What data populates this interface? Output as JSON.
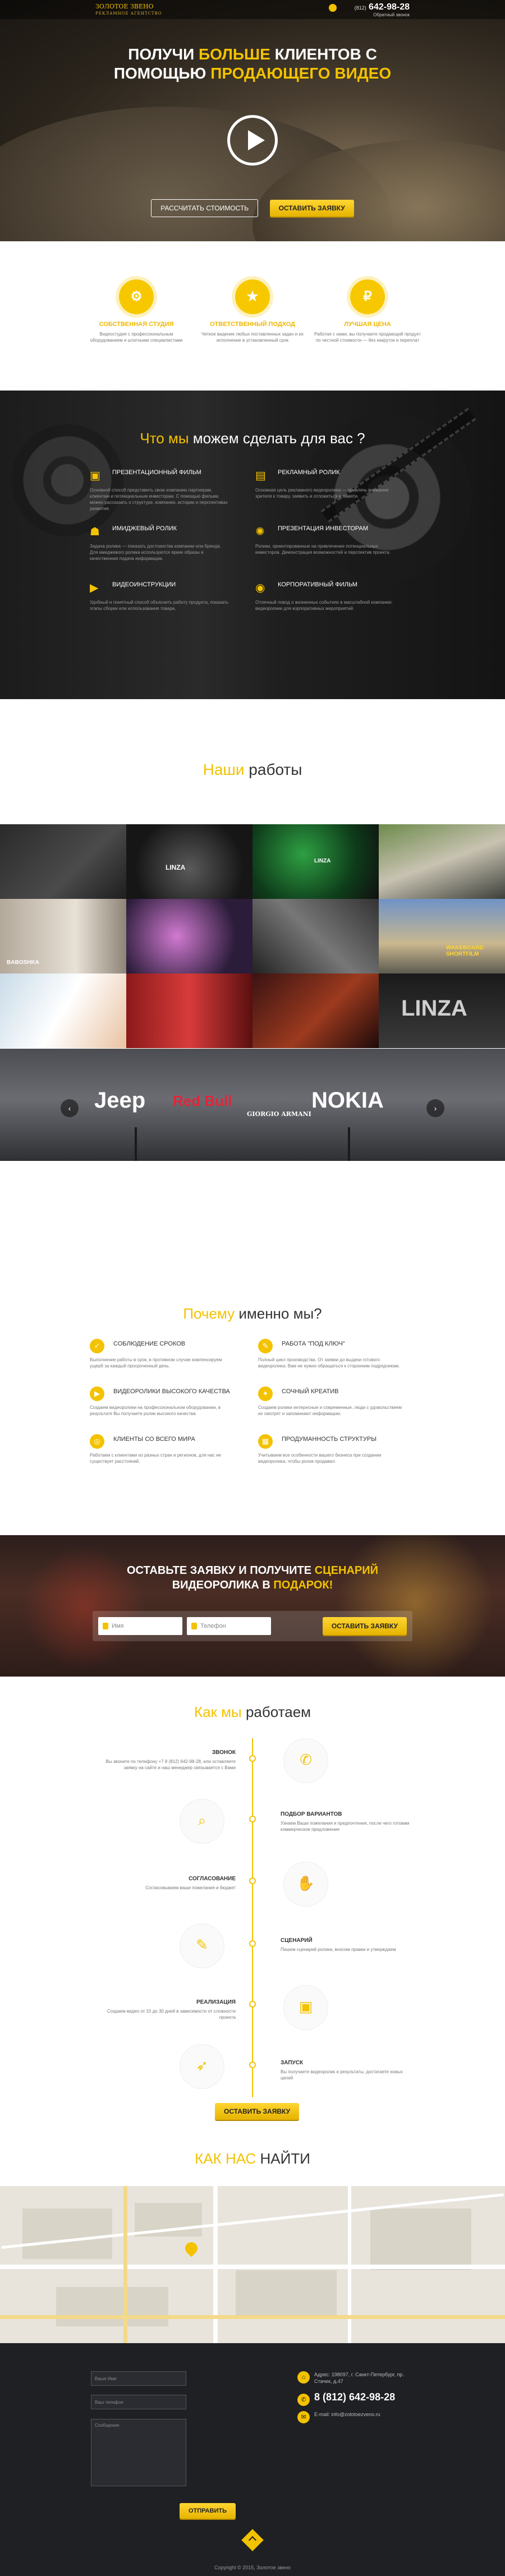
{
  "header": {
    "logo": "ЗОЛОТОЕ ЗВЕНО",
    "logo_sub": "РЕКЛАМНОЕ АГЕНТСТВО",
    "phone_code": "(812)",
    "phone": "642-98-28",
    "callback": "Обратный звонок"
  },
  "hero": {
    "title_1": "Получи",
    "title_2": "больше",
    "title_3": "клиентов с",
    "title_4": "помощью",
    "title_5": "продающего видео",
    "btn_cost": "Рассчитать стоимость",
    "btn_order": "Оставить заявку"
  },
  "features": [
    {
      "icon": "⚙",
      "title": "Собственная студия",
      "desc": "Видеостудия с профессиональным оборудованием и штатными специалистами"
    },
    {
      "icon": "★",
      "title": "Ответственный подход",
      "desc": "Четкое видение любых поставленных задач и их исполнение в установленный срок"
    },
    {
      "icon": "₽",
      "title": "Лучшая цена",
      "desc": "Работая с нами, вы получаете продающий продукт по честной стоимости — без накруток и переплат"
    }
  ],
  "services": {
    "title_1": "Что мы",
    "title_2": "можем",
    "title_3": "сделать для вас ?",
    "items": [
      {
        "icon": "▣",
        "title": "Презентационный фильм",
        "desc": "Основной способ представить свою компанию партнерам, клиентам и потенциальным инвесторам. С помощью фильма можно рассказать о структуре, компании, истории и перспективах развития."
      },
      {
        "icon": "▤",
        "title": "Рекламный ролик",
        "desc": "Основная цель рекламного видеоролика — привлечь внимание зрителя к товару, заявить и отложиться в памяти."
      },
      {
        "icon": "☗",
        "title": "Имиджевый ролик",
        "desc": "Задача ролика — показать достоинства компании или бренда. Для имиджевого ролика используются яркие образы и качественная подача информации."
      },
      {
        "icon": "✺",
        "title": "Презентация инвесторам",
        "desc": "Ролики, ориентированные на привлечение потенциальных инвесторов. Демонстрация возможностей и перспектив проекта."
      },
      {
        "icon": "▶",
        "title": "Видеоинструкции",
        "desc": "Удобный и понятный способ объяснить работу продукта, показать этапы сборки или использования товара."
      },
      {
        "icon": "◉",
        "title": "Корпоративный фильм",
        "desc": "Отличный повод о жизненных событиях в масштабной компании: видеоролики для корпоративных мероприятий."
      }
    ]
  },
  "works": {
    "title_1": "Наши",
    "title_2": "работы",
    "labels": {
      "linza": "LINZA",
      "bavoshka": "BABOSHKA",
      "brand_cell": "LINZA",
      "wake": "WAKEBOARD SHORTFILM",
      "linza_big": "LINZA"
    },
    "brands": [
      "Jeep",
      "Red Bull",
      "GIORGIO ARMANI",
      "NOKIA"
    ]
  },
  "why": {
    "title_1": "Почему",
    "title_2": "именно мы?",
    "items": [
      {
        "icon": "✓",
        "title": "Соблюдение сроков",
        "desc": "Выполнение работы в срок, в противном случае компенсируем ущерб за каждый просроченный день."
      },
      {
        "icon": "✎",
        "title": "Работа \"под ключ\"",
        "desc": "Полный цикл производства. От заявки до выдачи готового видеоролика. Вам не нужно обращаться к сторонним подрядчикам."
      },
      {
        "icon": "▶",
        "title": "Видеоролики высокого качества",
        "desc": "Создаем видеоролики на профессиональном оборудовании, в результате Вы получаете ролик высокого качества."
      },
      {
        "icon": "✦",
        "title": "Сочный креатив",
        "desc": "Создаем ролики интересные и современные, люди с удовольствием их смотрят и запоминают информацию."
      },
      {
        "icon": "◎",
        "title": "Клиенты со всего мира",
        "desc": "Работаем с клиентами из разных стран и регионов, для нас не существует расстояний."
      },
      {
        "icon": "▦",
        "title": "Продуманность структуры",
        "desc": "Учитываем все особенности вашего бизнеса при создании видеоролика, чтобы ролик продавал."
      }
    ]
  },
  "cta": {
    "title_1": "Оставьте заявку и получите",
    "title_2": "сценарий",
    "title_3": "видеоролика в",
    "title_4": "подарок!",
    "name_ph": "Имя",
    "phone_ph": "Телефон",
    "btn": "Оставить заявку"
  },
  "process": {
    "title_1": "Как мы",
    "title_2": "работаем",
    "steps": [
      {
        "title": "Звонок",
        "desc": "Вы звоните по телефону +7 8 (812) 642-98-28, или оставляете заявку на сайте и наш менеджер связывается с Вами"
      },
      {
        "title": "Подбор вариантов",
        "desc": "Узнаем Ваши пожелания и предпочтения, после чего готовим коммерческое предложение"
      },
      {
        "title": "Согласование",
        "desc": "Согласовываем ваши пожелания и бюджет"
      },
      {
        "title": "Сценарий",
        "desc": "Пишем сценарий ролика, вносим правки и утверждаем"
      },
      {
        "title": "Реализация",
        "desc": "Создаем видео от 10 до 30 дней в зависимости от сложности проекта"
      },
      {
        "title": "Запуск",
        "desc": "Вы получаете видеоролик и результаты, достигаете новых целей"
      }
    ],
    "btn": "Оставить заявку"
  },
  "map": {
    "title_1": "Как нас",
    "title_2": "найти"
  },
  "footer": {
    "name_ph": "Ваше Имя",
    "phone_ph": "Ваш телефон",
    "msg_ph": "Сообщение",
    "send": "Отправить",
    "address": "Адрес: 198097, г. Санкт-Петербург, пр. Стачек, д.47",
    "phone": "8 (812) 642-98-28",
    "email": "E-mail: info@zolotoezveno.ru",
    "copyright": "Copyright © 2015, Золотое звено"
  },
  "colors": {
    "accent": "#f3c200",
    "dark": "#1f2024"
  }
}
